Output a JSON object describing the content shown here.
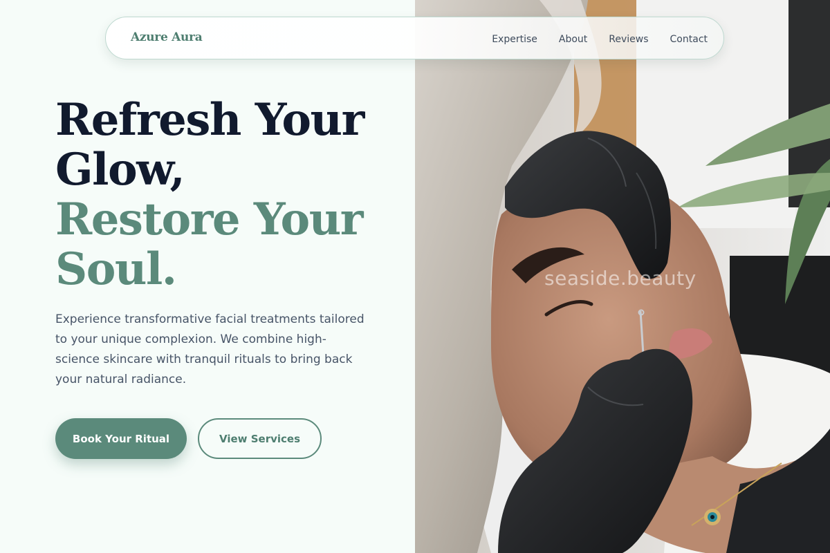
{
  "nav": {
    "brand": "Azure Aura",
    "links": [
      "Expertise",
      "About",
      "Reviews",
      "Contact"
    ]
  },
  "hero": {
    "headline_line1": "Refresh Your",
    "headline_line2": "Glow,",
    "headline_line3": "Restore Your",
    "headline_line4": "Soul.",
    "description": "Experience transformative facial treatments tailored to your unique complexion. We combine high-science skincare with tranquil rituals to bring back your natural radiance.",
    "primary_button": "Book Your Ritual",
    "secondary_button": "View Services"
  },
  "photo": {
    "watermark": "seaside.beauty"
  },
  "colors": {
    "accent": "#5b8a7b",
    "heading_dark": "#111a2e",
    "body_text": "#475467",
    "background": "#f6fcf9"
  }
}
